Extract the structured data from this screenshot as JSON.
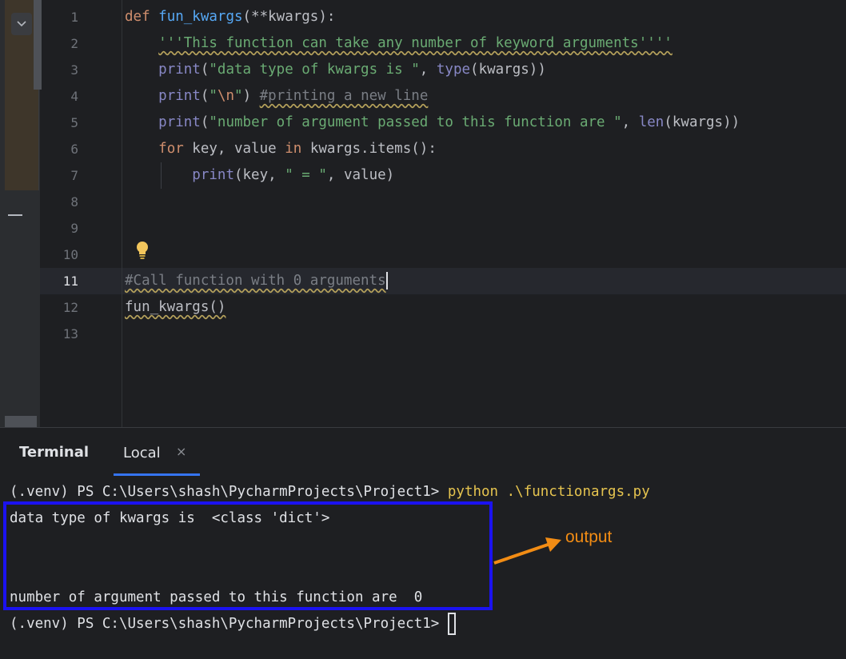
{
  "editor": {
    "line_numbers": [
      "1",
      "2",
      "3",
      "4",
      "5",
      "6",
      "7",
      "8",
      "9",
      "10",
      "11",
      "12",
      "13"
    ],
    "active_line": "11",
    "code": {
      "l1_def": "def",
      "l1_name": "fun_kwargs",
      "l1_rest": "(**kwargs):",
      "l2_doc": "'''This function can take any number of keyword arguments''''",
      "l3_print": "print",
      "l3_open": "(",
      "l3_str": "\"data type of kwargs is \"",
      "l3_comma": ", ",
      "l3_type": "type",
      "l3_rest": "(kwargs))",
      "l4_print": "print",
      "l4_open": "(",
      "l4_q1": "\"",
      "l4_esc": "\\n",
      "l4_q2": "\"",
      "l4_close": ") ",
      "l4_comment": "#printing a new line",
      "l5_print": "print",
      "l5_open": "(",
      "l5_str": "\"number of argument passed to this function are \"",
      "l5_comma": ", ",
      "l5_len": "len",
      "l5_rest": "(kwargs))",
      "l6_for": "for",
      "l6_mid": " key, value ",
      "l6_in": "in",
      "l6_rest": " kwargs.items():",
      "l7_print": "print",
      "l7_open": "(key, ",
      "l7_str": "\" = \"",
      "l7_rest": ", value)",
      "l11_comment": "#Call function with 0 arguments",
      "l12_call": "fun_kwargs()"
    }
  },
  "terminal": {
    "title": "Terminal",
    "tab_label": "Local",
    "close_glyph": "×",
    "prompt": "(.venv) PS C:\\Users\\shash\\PycharmProjects\\Project1> ",
    "command": "python .\\functionargs.py",
    "output_lines": [
      "data type of kwargs is  <class 'dict'>",
      "",
      "",
      "number of argument passed to this function are  0"
    ],
    "prompt2": "(.venv) PS C:\\Users\\shash\\PycharmProjects\\Project1> "
  },
  "annotation": {
    "label": "output",
    "box_color": "#1b12f0",
    "arrow_color": "#f28c14"
  }
}
